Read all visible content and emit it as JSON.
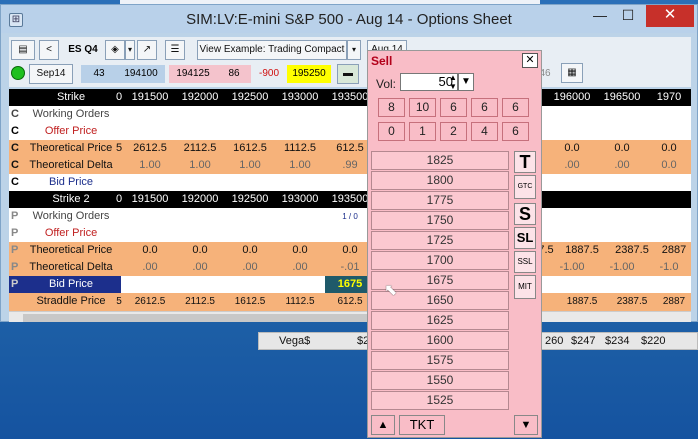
{
  "window": {
    "title": "SIM:LV:E-mini S&P 500 - Aug 14 - Options Sheet",
    "minimize_glyph": "—",
    "maximize_glyph": "☐",
    "close_glyph": "✕"
  },
  "toolbar": {
    "back_label": "<",
    "symbol": "ES Q4",
    "view_label": "View Example: Trading Compact",
    "expiry_select": "Aug 14",
    "month_label": "Sep14",
    "num_a": "43",
    "num_b": "194100",
    "num_c": "194125",
    "num_d": "86",
    "num_e": "-900",
    "num_f": "195250",
    "right_num": "46"
  },
  "grid": {
    "call_strikes": [
      "191500",
      "192000",
      "192500",
      "193000",
      "193500"
    ],
    "call_strikes_right": [
      "196000",
      "196500",
      "1970"
    ],
    "put_strikes": [
      "191500",
      "192000",
      "192500",
      "193000",
      "193500"
    ],
    "rows": {
      "strike": "Strike",
      "working_orders": "Working Orders",
      "offer_price": "Offer Price",
      "theoretical_price": "Theoretical Price",
      "theoretical_delta": "Theoretical Delta",
      "bid_price": "Bid Price",
      "strike2": "Strike 2",
      "straddle_price": "Straddle Price"
    },
    "side_call": "C",
    "side_put": "P",
    "edge_zero": "0",
    "edge_five": "5",
    "call_theo": [
      "2612.5",
      "2112.5",
      "1612.5",
      "1112.5",
      "612.5"
    ],
    "call_theo_right": [
      "0.0",
      "0.0",
      "0.0"
    ],
    "call_delta": [
      "1.00",
      "1.00",
      "1.00",
      "1.00",
      ".99"
    ],
    "call_delta_right": [
      ".00",
      ".00",
      "0.0"
    ],
    "put_working": "1 / 0",
    "put_theo": [
      "0.0",
      "0.0",
      "0.0",
      "0.0",
      "0.0"
    ],
    "put_theo_right": [
      "7.5",
      "1887.5",
      "2387.5",
      "2887"
    ],
    "put_delta": [
      ".00",
      ".00",
      ".00",
      ".00",
      "-.01"
    ],
    "put_delta_right": [
      "-1.00",
      "-1.00",
      "-1.0"
    ],
    "put_bid_highlight": "1675",
    "straddle": [
      "2612.5",
      "2112.5",
      "1612.5",
      "1112.5",
      "612.5"
    ],
    "straddle_right": [
      "1887.5",
      "2387.5",
      "2887"
    ]
  },
  "popup": {
    "title": "Sell",
    "vol_label": "Vol:",
    "vol_value": "50",
    "qty_row1": [
      "8",
      "10",
      "6",
      "6",
      "6"
    ],
    "qty_row2": [
      "0",
      "1",
      "2",
      "4",
      "6"
    ],
    "prices": [
      "1825",
      "1800",
      "1775",
      "1750",
      "1725",
      "1700",
      "1675",
      "1650",
      "1625",
      "1600",
      "1575",
      "1550",
      "1525"
    ],
    "btn_t": "T",
    "btn_gtc": "GTC",
    "btn_s": "S",
    "btn_sl": "SL",
    "btn_ssl": "SSL",
    "btn_mit": "MIT",
    "btn_tkt": "TKT"
  },
  "bottom": {
    "vega_label": "Vega$",
    "vega_partial": "$2",
    "vals": [
      "260",
      "$247",
      "$234",
      "$220"
    ]
  },
  "colors": {
    "popup_bg": "#f9bdc7",
    "theo_row": "#f6b27a",
    "header_row": "#000000",
    "bid_highlight": "#1f5a6a",
    "yellow": "#ffff00"
  }
}
